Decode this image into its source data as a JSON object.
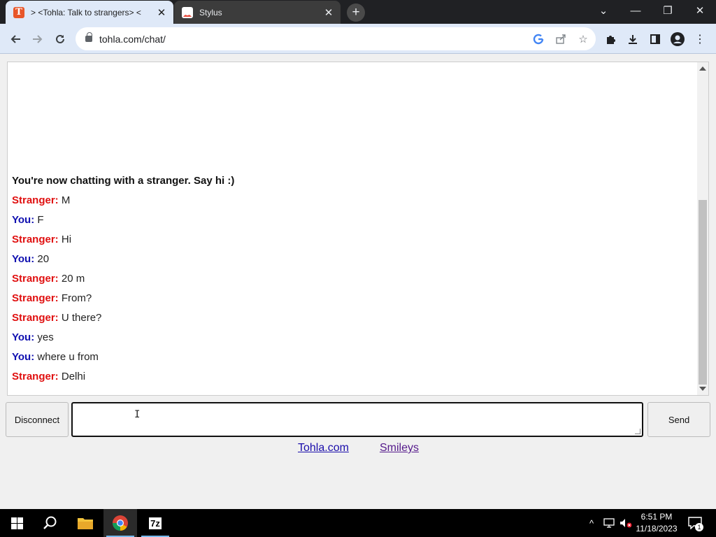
{
  "browser": {
    "tabs": [
      {
        "title": "> <Tohla: Talk to strangers> <",
        "favicon": "T",
        "active": true
      },
      {
        "title": "Stylus",
        "active": false
      }
    ],
    "new_tab_label": "+",
    "address": "tohla.com/chat/",
    "controls": {
      "minimize": "—",
      "restore": "❐",
      "close": "✕",
      "tab_search": "⌄"
    }
  },
  "chat": {
    "status": "You're now chatting with a stranger. Say hi :)",
    "messages": [
      {
        "speaker": "Stranger:",
        "role": "stranger",
        "text": "M"
      },
      {
        "speaker": "You:",
        "role": "you",
        "text": "F"
      },
      {
        "speaker": "Stranger:",
        "role": "stranger",
        "text": "Hi"
      },
      {
        "speaker": "You:",
        "role": "you",
        "text": "20"
      },
      {
        "speaker": "Stranger:",
        "role": "stranger",
        "text": "20 m"
      },
      {
        "speaker": "Stranger:",
        "role": "stranger",
        "text": "From?"
      },
      {
        "speaker": "Stranger:",
        "role": "stranger",
        "text": "U there?"
      },
      {
        "speaker": "You:",
        "role": "you",
        "text": "yes"
      },
      {
        "speaker": "You:",
        "role": "you",
        "text": "where u from"
      },
      {
        "speaker": "Stranger:",
        "role": "stranger",
        "text": "Delhi"
      }
    ],
    "colors": {
      "stranger": "#e01010",
      "you": "#1010b0"
    }
  },
  "controls": {
    "disconnect_label": "Disconnect",
    "send_label": "Send",
    "message_value": ""
  },
  "footer": {
    "links": [
      {
        "label": "Tohla.com"
      },
      {
        "label": "Smileys"
      }
    ]
  },
  "taskbar": {
    "time": "6:51 PM",
    "date": "11/18/2023",
    "notification_count": "1",
    "sevenzip_label": "7z"
  }
}
